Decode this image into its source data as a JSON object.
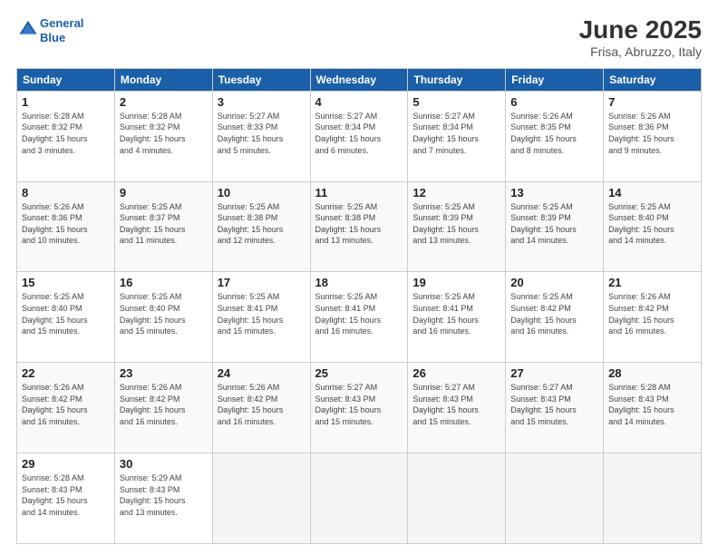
{
  "logo": {
    "line1": "General",
    "line2": "Blue"
  },
  "title": "June 2025",
  "subtitle": "Frisa, Abruzzo, Italy",
  "header_days": [
    "Sunday",
    "Monday",
    "Tuesday",
    "Wednesday",
    "Thursday",
    "Friday",
    "Saturday"
  ],
  "weeks": [
    [
      {
        "day": "1",
        "sunrise": "5:28 AM",
        "sunset": "8:32 PM",
        "daylight": "15 hours and 3 minutes."
      },
      {
        "day": "2",
        "sunrise": "5:28 AM",
        "sunset": "8:32 PM",
        "daylight": "15 hours and 4 minutes."
      },
      {
        "day": "3",
        "sunrise": "5:27 AM",
        "sunset": "8:33 PM",
        "daylight": "15 hours and 5 minutes."
      },
      {
        "day": "4",
        "sunrise": "5:27 AM",
        "sunset": "8:34 PM",
        "daylight": "15 hours and 6 minutes."
      },
      {
        "day": "5",
        "sunrise": "5:27 AM",
        "sunset": "8:34 PM",
        "daylight": "15 hours and 7 minutes."
      },
      {
        "day": "6",
        "sunrise": "5:26 AM",
        "sunset": "8:35 PM",
        "daylight": "15 hours and 8 minutes."
      },
      {
        "day": "7",
        "sunrise": "5:26 AM",
        "sunset": "8:36 PM",
        "daylight": "15 hours and 9 minutes."
      }
    ],
    [
      {
        "day": "8",
        "sunrise": "5:26 AM",
        "sunset": "8:36 PM",
        "daylight": "15 hours and 10 minutes."
      },
      {
        "day": "9",
        "sunrise": "5:25 AM",
        "sunset": "8:37 PM",
        "daylight": "15 hours and 11 minutes."
      },
      {
        "day": "10",
        "sunrise": "5:25 AM",
        "sunset": "8:38 PM",
        "daylight": "15 hours and 12 minutes."
      },
      {
        "day": "11",
        "sunrise": "5:25 AM",
        "sunset": "8:38 PM",
        "daylight": "15 hours and 13 minutes."
      },
      {
        "day": "12",
        "sunrise": "5:25 AM",
        "sunset": "8:39 PM",
        "daylight": "15 hours and 13 minutes."
      },
      {
        "day": "13",
        "sunrise": "5:25 AM",
        "sunset": "8:39 PM",
        "daylight": "15 hours and 14 minutes."
      },
      {
        "day": "14",
        "sunrise": "5:25 AM",
        "sunset": "8:40 PM",
        "daylight": "15 hours and 14 minutes."
      }
    ],
    [
      {
        "day": "15",
        "sunrise": "5:25 AM",
        "sunset": "8:40 PM",
        "daylight": "15 hours and 15 minutes."
      },
      {
        "day": "16",
        "sunrise": "5:25 AM",
        "sunset": "8:40 PM",
        "daylight": "15 hours and 15 minutes."
      },
      {
        "day": "17",
        "sunrise": "5:25 AM",
        "sunset": "8:41 PM",
        "daylight": "15 hours and 15 minutes."
      },
      {
        "day": "18",
        "sunrise": "5:25 AM",
        "sunset": "8:41 PM",
        "daylight": "15 hours and 16 minutes."
      },
      {
        "day": "19",
        "sunrise": "5:25 AM",
        "sunset": "8:41 PM",
        "daylight": "15 hours and 16 minutes."
      },
      {
        "day": "20",
        "sunrise": "5:25 AM",
        "sunset": "8:42 PM",
        "daylight": "15 hours and 16 minutes."
      },
      {
        "day": "21",
        "sunrise": "5:26 AM",
        "sunset": "8:42 PM",
        "daylight": "15 hours and 16 minutes."
      }
    ],
    [
      {
        "day": "22",
        "sunrise": "5:26 AM",
        "sunset": "8:42 PM",
        "daylight": "15 hours and 16 minutes."
      },
      {
        "day": "23",
        "sunrise": "5:26 AM",
        "sunset": "8:42 PM",
        "daylight": "15 hours and 16 minutes."
      },
      {
        "day": "24",
        "sunrise": "5:26 AM",
        "sunset": "8:42 PM",
        "daylight": "15 hours and 16 minutes."
      },
      {
        "day": "25",
        "sunrise": "5:27 AM",
        "sunset": "8:43 PM",
        "daylight": "15 hours and 15 minutes."
      },
      {
        "day": "26",
        "sunrise": "5:27 AM",
        "sunset": "8:43 PM",
        "daylight": "15 hours and 15 minutes."
      },
      {
        "day": "27",
        "sunrise": "5:27 AM",
        "sunset": "8:43 PM",
        "daylight": "15 hours and 15 minutes."
      },
      {
        "day": "28",
        "sunrise": "5:28 AM",
        "sunset": "8:43 PM",
        "daylight": "15 hours and 14 minutes."
      }
    ],
    [
      {
        "day": "29",
        "sunrise": "5:28 AM",
        "sunset": "8:43 PM",
        "daylight": "15 hours and 14 minutes."
      },
      {
        "day": "30",
        "sunrise": "5:29 AM",
        "sunset": "8:43 PM",
        "daylight": "15 hours and 13 minutes."
      },
      null,
      null,
      null,
      null,
      null
    ]
  ],
  "labels": {
    "sunrise": "Sunrise:",
    "sunset": "Sunset:",
    "daylight": "Daylight:"
  }
}
